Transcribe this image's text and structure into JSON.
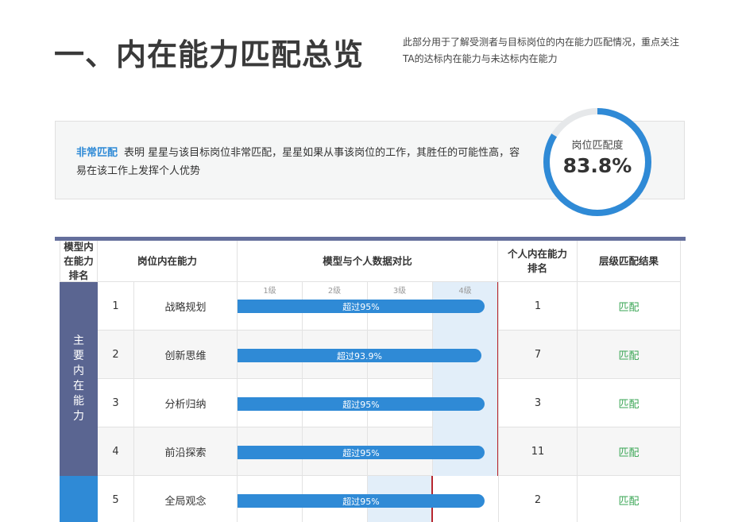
{
  "title": "一、内在能力匹配总览",
  "description": "此部分用于了解受测者与目标岗位的内在能力匹配情况，重点关注TA的达标内在能力与未达标内在能力",
  "summary": {
    "tag": "非常匹配",
    "text": "表明 星星与该目标岗位非常匹配，星星如果从事该岗位的工作，其胜任的可能性高，容易在该工作上发挥个人优势"
  },
  "gauge": {
    "label": "岗位匹配度",
    "value": "83.8%",
    "fraction": 0.838
  },
  "colors": {
    "accent": "#2f8ad6",
    "group_main": "#5a6591",
    "group_second": "#2f8ad6",
    "match": "#3aa655",
    "required_line": "#b8262e"
  },
  "table": {
    "headers": {
      "rank": "模型内在能力排名",
      "competency": "岗位内在能力",
      "compare": "模型与个人数据对比",
      "personal_rank": "个人内在能力排名",
      "result": "层级匹配结果"
    },
    "levels": [
      "1级",
      "2级",
      "3级",
      "4级"
    ],
    "groups": [
      {
        "label": "主要内在能力"
      }
    ],
    "rows": [
      {
        "rank": "1",
        "name": "战略规划",
        "bar_label": "超过95%",
        "bar_fraction": 0.95,
        "required_level": 4,
        "personal_rank": "1",
        "result": "匹配"
      },
      {
        "rank": "2",
        "name": "创新思维",
        "bar_label": "超过93.9%",
        "bar_fraction": 0.939,
        "required_level": 4,
        "personal_rank": "7",
        "result": "匹配"
      },
      {
        "rank": "3",
        "name": "分析归纳",
        "bar_label": "超过95%",
        "bar_fraction": 0.95,
        "required_level": 4,
        "personal_rank": "3",
        "result": "匹配"
      },
      {
        "rank": "4",
        "name": "前沿探索",
        "bar_label": "超过95%",
        "bar_fraction": 0.95,
        "required_level": 4,
        "personal_rank": "11",
        "result": "匹配"
      },
      {
        "rank": "5",
        "name": "全局观念",
        "bar_label": "超过95%",
        "bar_fraction": 0.95,
        "required_level": 3,
        "personal_rank": "2",
        "result": "匹配"
      }
    ]
  }
}
